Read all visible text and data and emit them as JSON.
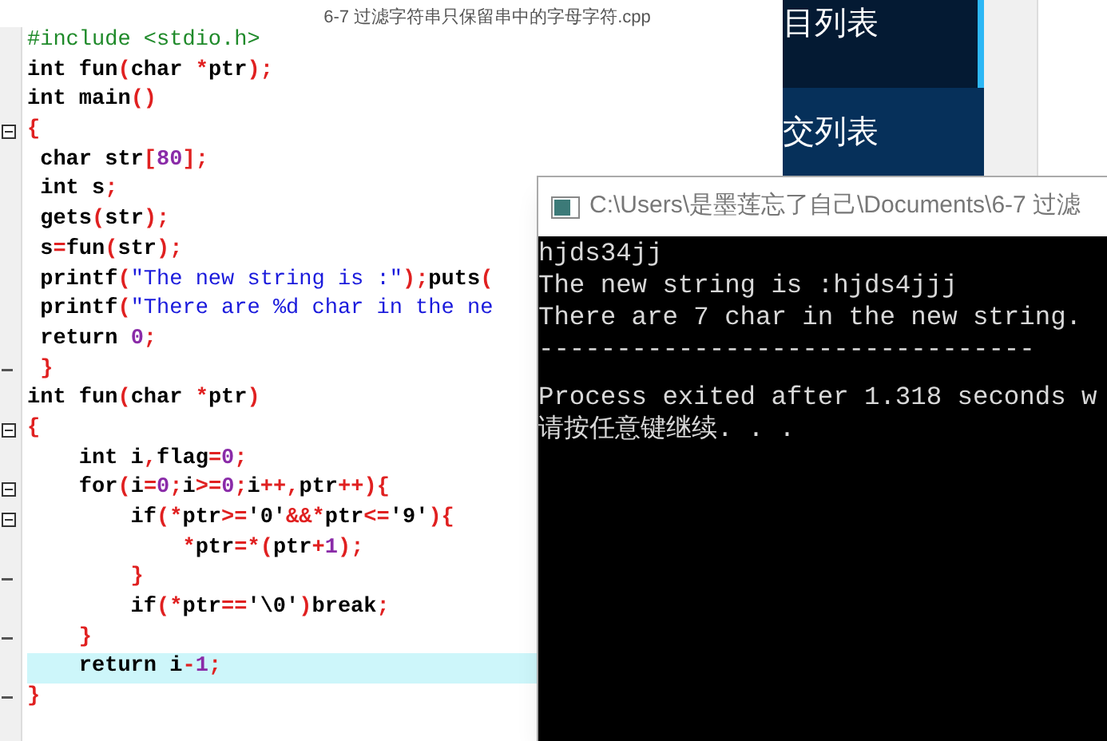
{
  "editor": {
    "file_title": "6-7 过滤字符串只保留串中的字母字符.cpp",
    "lines": [
      {
        "kind": "plain",
        "highlighted": false,
        "tokens": [
          {
            "kind": "pre",
            "text": "#include <stdio.h>"
          }
        ]
      },
      {
        "kind": "plain",
        "highlighted": false,
        "tokens": [
          {
            "kind": "kw",
            "text": "int fun"
          },
          {
            "kind": "p",
            "text": "("
          },
          {
            "kind": "kw",
            "text": "char "
          },
          {
            "kind": "p",
            "text": "*"
          },
          {
            "kind": "kw",
            "text": "ptr"
          },
          {
            "kind": "p",
            "text": ");"
          }
        ]
      },
      {
        "kind": "plain",
        "highlighted": false,
        "tokens": [
          {
            "kind": "kw",
            "text": "int main"
          },
          {
            "kind": "p",
            "text": "()"
          }
        ]
      },
      {
        "kind": "fold_start",
        "highlighted": false,
        "tokens": [
          {
            "kind": "p",
            "text": "{"
          }
        ]
      },
      {
        "kind": "plain",
        "highlighted": false,
        "tokens": [
          {
            "kind": "kw",
            "text": " char str"
          },
          {
            "kind": "p",
            "text": "["
          },
          {
            "kind": "num",
            "text": "80"
          },
          {
            "kind": "p",
            "text": "];"
          }
        ]
      },
      {
        "kind": "plain",
        "highlighted": false,
        "tokens": [
          {
            "kind": "kw",
            "text": " int s"
          },
          {
            "kind": "p",
            "text": ";"
          }
        ]
      },
      {
        "kind": "plain",
        "highlighted": false,
        "tokens": [
          {
            "kind": "kw",
            "text": " gets"
          },
          {
            "kind": "p",
            "text": "("
          },
          {
            "kind": "kw",
            "text": "str"
          },
          {
            "kind": "p",
            "text": ");"
          }
        ]
      },
      {
        "kind": "plain",
        "highlighted": false,
        "tokens": [
          {
            "kind": "kw",
            "text": " s"
          },
          {
            "kind": "p",
            "text": "="
          },
          {
            "kind": "kw",
            "text": "fun"
          },
          {
            "kind": "p",
            "text": "("
          },
          {
            "kind": "kw",
            "text": "str"
          },
          {
            "kind": "p",
            "text": ");"
          }
        ]
      },
      {
        "kind": "plain",
        "highlighted": false,
        "tokens": [
          {
            "kind": "kw",
            "text": " printf"
          },
          {
            "kind": "p",
            "text": "("
          },
          {
            "kind": "str",
            "text": "\"The new string is :\""
          },
          {
            "kind": "p",
            "text": ");"
          },
          {
            "kind": "kw",
            "text": "puts"
          },
          {
            "kind": "p",
            "text": "("
          }
        ]
      },
      {
        "kind": "plain",
        "highlighted": false,
        "tokens": [
          {
            "kind": "kw",
            "text": " printf"
          },
          {
            "kind": "p",
            "text": "("
          },
          {
            "kind": "str",
            "text": "\"There are %d char in the ne"
          }
        ]
      },
      {
        "kind": "plain",
        "highlighted": false,
        "tokens": [
          {
            "kind": "kw",
            "text": " return "
          },
          {
            "kind": "num",
            "text": "0"
          },
          {
            "kind": "p",
            "text": ";"
          }
        ]
      },
      {
        "kind": "fold_end",
        "highlighted": false,
        "tokens": [
          {
            "kind": "p",
            "text": " }"
          }
        ]
      },
      {
        "kind": "plain",
        "highlighted": false,
        "tokens": [
          {
            "kind": "kw",
            "text": "int fun"
          },
          {
            "kind": "p",
            "text": "("
          },
          {
            "kind": "kw",
            "text": "char "
          },
          {
            "kind": "p",
            "text": "*"
          },
          {
            "kind": "kw",
            "text": "ptr"
          },
          {
            "kind": "p",
            "text": ")"
          }
        ]
      },
      {
        "kind": "fold_start",
        "highlighted": false,
        "tokens": [
          {
            "kind": "p",
            "text": "{"
          }
        ]
      },
      {
        "kind": "plain",
        "highlighted": false,
        "tokens": [
          {
            "kind": "kw",
            "text": "    int i"
          },
          {
            "kind": "p",
            "text": ","
          },
          {
            "kind": "kw",
            "text": "flag"
          },
          {
            "kind": "p",
            "text": "="
          },
          {
            "kind": "num",
            "text": "0"
          },
          {
            "kind": "p",
            "text": ";"
          }
        ]
      },
      {
        "kind": "fold_start",
        "highlighted": false,
        "tokens": [
          {
            "kind": "kw",
            "text": "    for"
          },
          {
            "kind": "p",
            "text": "("
          },
          {
            "kind": "kw",
            "text": "i"
          },
          {
            "kind": "p",
            "text": "="
          },
          {
            "kind": "num",
            "text": "0"
          },
          {
            "kind": "p",
            "text": ";"
          },
          {
            "kind": "kw",
            "text": "i"
          },
          {
            "kind": "p",
            "text": ">="
          },
          {
            "kind": "num",
            "text": "0"
          },
          {
            "kind": "p",
            "text": ";"
          },
          {
            "kind": "kw",
            "text": "i"
          },
          {
            "kind": "p",
            "text": "++,"
          },
          {
            "kind": "kw",
            "text": "ptr"
          },
          {
            "kind": "p",
            "text": "++){"
          }
        ]
      },
      {
        "kind": "fold_start",
        "highlighted": false,
        "tokens": [
          {
            "kind": "kw",
            "text": "        if"
          },
          {
            "kind": "p",
            "text": "(*"
          },
          {
            "kind": "kw",
            "text": "ptr"
          },
          {
            "kind": "p",
            "text": ">="
          },
          {
            "kind": "kw",
            "text": "'0'"
          },
          {
            "kind": "p",
            "text": "&&*"
          },
          {
            "kind": "kw",
            "text": "ptr"
          },
          {
            "kind": "p",
            "text": "<="
          },
          {
            "kind": "kw",
            "text": "'9'"
          },
          {
            "kind": "p",
            "text": "){"
          }
        ]
      },
      {
        "kind": "plain",
        "highlighted": false,
        "tokens": [
          {
            "kind": "p",
            "text": "            *"
          },
          {
            "kind": "kw",
            "text": "ptr"
          },
          {
            "kind": "p",
            "text": "=*("
          },
          {
            "kind": "kw",
            "text": "ptr"
          },
          {
            "kind": "p",
            "text": "+"
          },
          {
            "kind": "num",
            "text": "1"
          },
          {
            "kind": "p",
            "text": ");"
          }
        ]
      },
      {
        "kind": "fold_end",
        "highlighted": false,
        "tokens": [
          {
            "kind": "p",
            "text": "        }"
          }
        ]
      },
      {
        "kind": "plain",
        "highlighted": false,
        "tokens": [
          {
            "kind": "kw",
            "text": "        if"
          },
          {
            "kind": "p",
            "text": "(*"
          },
          {
            "kind": "kw",
            "text": "ptr"
          },
          {
            "kind": "p",
            "text": "=="
          },
          {
            "kind": "kw",
            "text": "'\\0'"
          },
          {
            "kind": "p",
            "text": ")"
          },
          {
            "kind": "kw",
            "text": "break"
          },
          {
            "kind": "p",
            "text": ";"
          }
        ]
      },
      {
        "kind": "fold_end",
        "highlighted": false,
        "tokens": [
          {
            "kind": "p",
            "text": "    }"
          }
        ]
      },
      {
        "kind": "plain",
        "highlighted": true,
        "tokens": [
          {
            "kind": "kw",
            "text": "    return i"
          },
          {
            "kind": "p",
            "text": "-"
          },
          {
            "kind": "num",
            "text": "1"
          },
          {
            "kind": "p",
            "text": ";"
          }
        ]
      },
      {
        "kind": "fold_end",
        "highlighted": false,
        "tokens": [
          {
            "kind": "p",
            "text": "}"
          }
        ]
      }
    ]
  },
  "side_menu": [
    {
      "label": "目列表",
      "selected": true
    },
    {
      "label": "交列表",
      "selected": false
    }
  ],
  "console": {
    "title": "C:\\Users\\是墨莲忘了自己\\Documents\\6-7 过滤",
    "output": [
      "hjds34jj",
      "The new string is :hjds4jjj",
      "There are 7 char in the new string.",
      "--------------------------------",
      "Process exited after 1.318 seconds w",
      "请按任意键继续. . ."
    ]
  }
}
